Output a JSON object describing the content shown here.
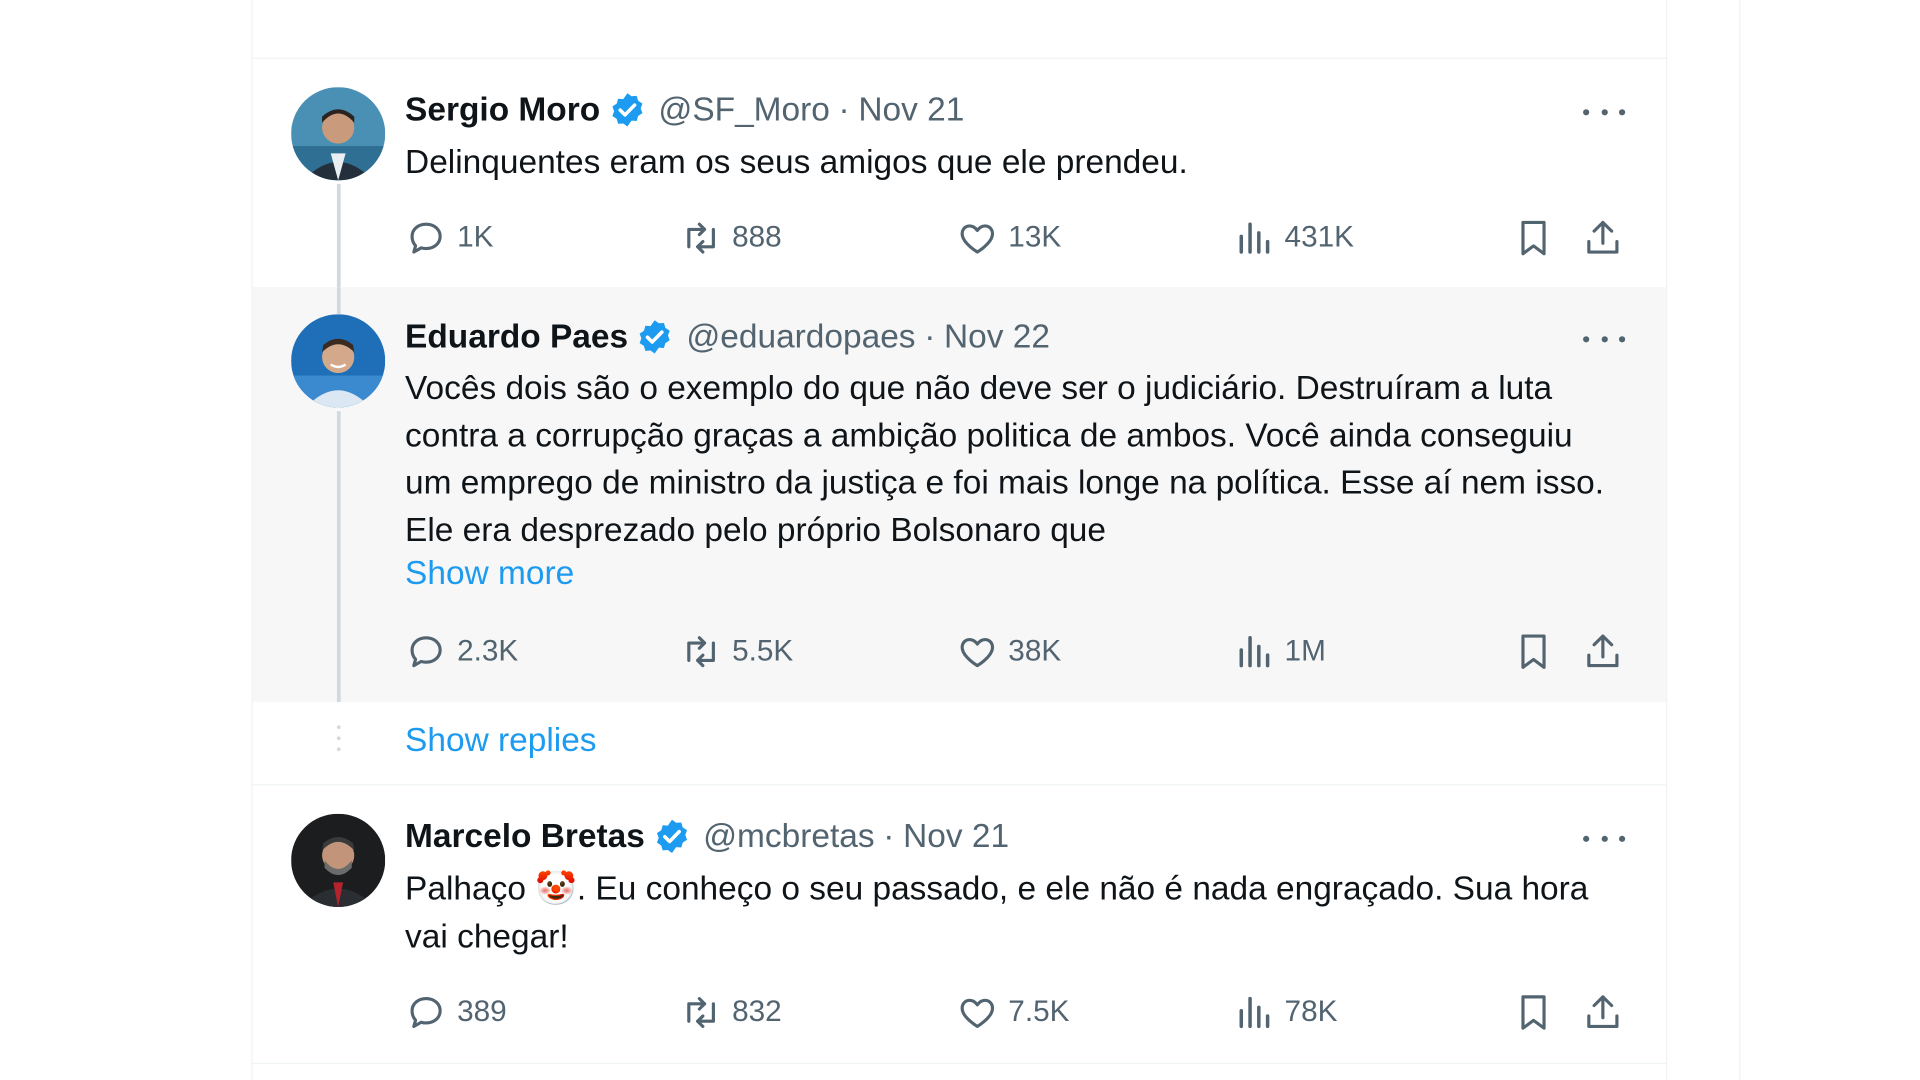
{
  "colors": {
    "accent": "#1d9bf0",
    "verified": "#1d9bf0",
    "text": "#0f1419",
    "muted": "#536471",
    "highlight_bg": "#f7f7f7"
  },
  "tweets": [
    {
      "name": "Sergio Moro",
      "handle": "@SF_Moro",
      "separator": "·",
      "date": "Nov 21",
      "text": "Delinquentes eram os seus amigos que ele prendeu.",
      "replies": "1K",
      "retweets": "888",
      "likes": "13K",
      "views": "431K"
    },
    {
      "name": "Eduardo Paes",
      "handle": "@eduardopaes",
      "separator": "·",
      "date": "Nov 22",
      "text": "Vocês dois são o exemplo do que não deve ser o judiciário. Destruíram a luta contra a corrupção graças a ambição politica de ambos. Você ainda conseguiu um emprego de ministro da justiça e foi mais longe na política. Esse aí nem isso. Ele era desprezado pelo próprio Bolsonaro que",
      "show_more": "Show more",
      "replies": "2.3K",
      "retweets": "5.5K",
      "likes": "38K",
      "views": "1M"
    },
    {
      "name": "Marcelo Bretas",
      "handle": "@mcbretas",
      "separator": "·",
      "date": "Nov 21",
      "text": "Palhaço 🤡. Eu conheço o seu passado, e ele não é nada engraçado. Sua hora vai chegar!",
      "replies": "389",
      "retweets": "832",
      "likes": "7.5K",
      "views": "78K"
    }
  ],
  "show_replies": "Show replies",
  "icons": [
    "verified-badge-icon",
    "more-icon",
    "reply-icon",
    "retweet-icon",
    "like-icon",
    "views-icon",
    "bookmark-icon",
    "share-icon"
  ]
}
